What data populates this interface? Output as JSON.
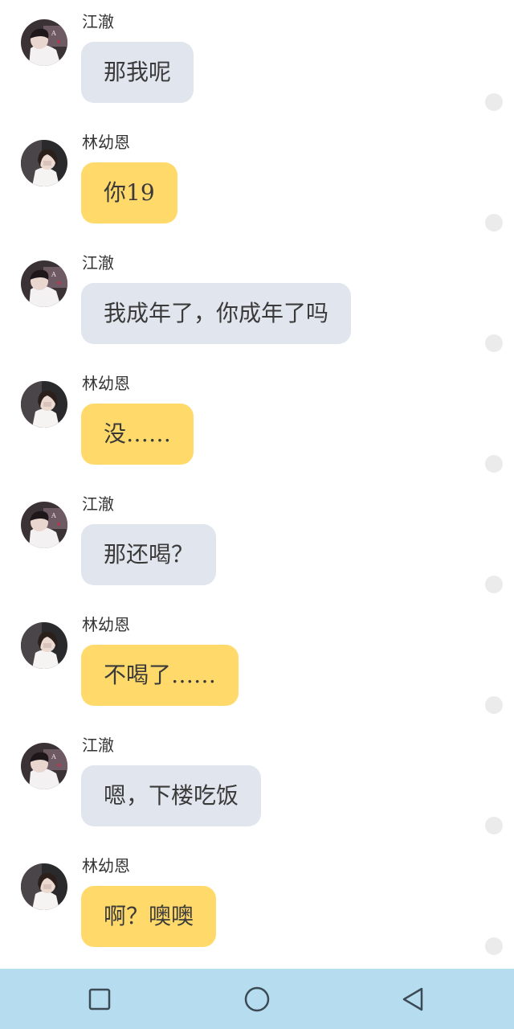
{
  "messages": [
    {
      "sender": "江澈",
      "side": "jiang",
      "text": "那我呢"
    },
    {
      "sender": "林幼恩",
      "side": "lin",
      "text": "你19"
    },
    {
      "sender": "江澈",
      "side": "jiang",
      "text": "我成年了，你成年了吗"
    },
    {
      "sender": "林幼恩",
      "side": "lin",
      "text": "没……"
    },
    {
      "sender": "江澈",
      "side": "jiang",
      "text": "那还喝？"
    },
    {
      "sender": "林幼恩",
      "side": "lin",
      "text": "不喝了……"
    },
    {
      "sender": "江澈",
      "side": "jiang",
      "text": "嗯，下楼吃饭"
    },
    {
      "sender": "林幼恩",
      "side": "lin",
      "text": "啊？噢噢"
    }
  ],
  "colors": {
    "jiang_bubble": "#e1e6ee",
    "lin_bubble": "#ffda6b",
    "navbar": "#b6dcf0"
  },
  "navbar": {
    "recent_icon": "square-icon",
    "home_icon": "circle-icon",
    "back_icon": "triangle-back-icon"
  }
}
